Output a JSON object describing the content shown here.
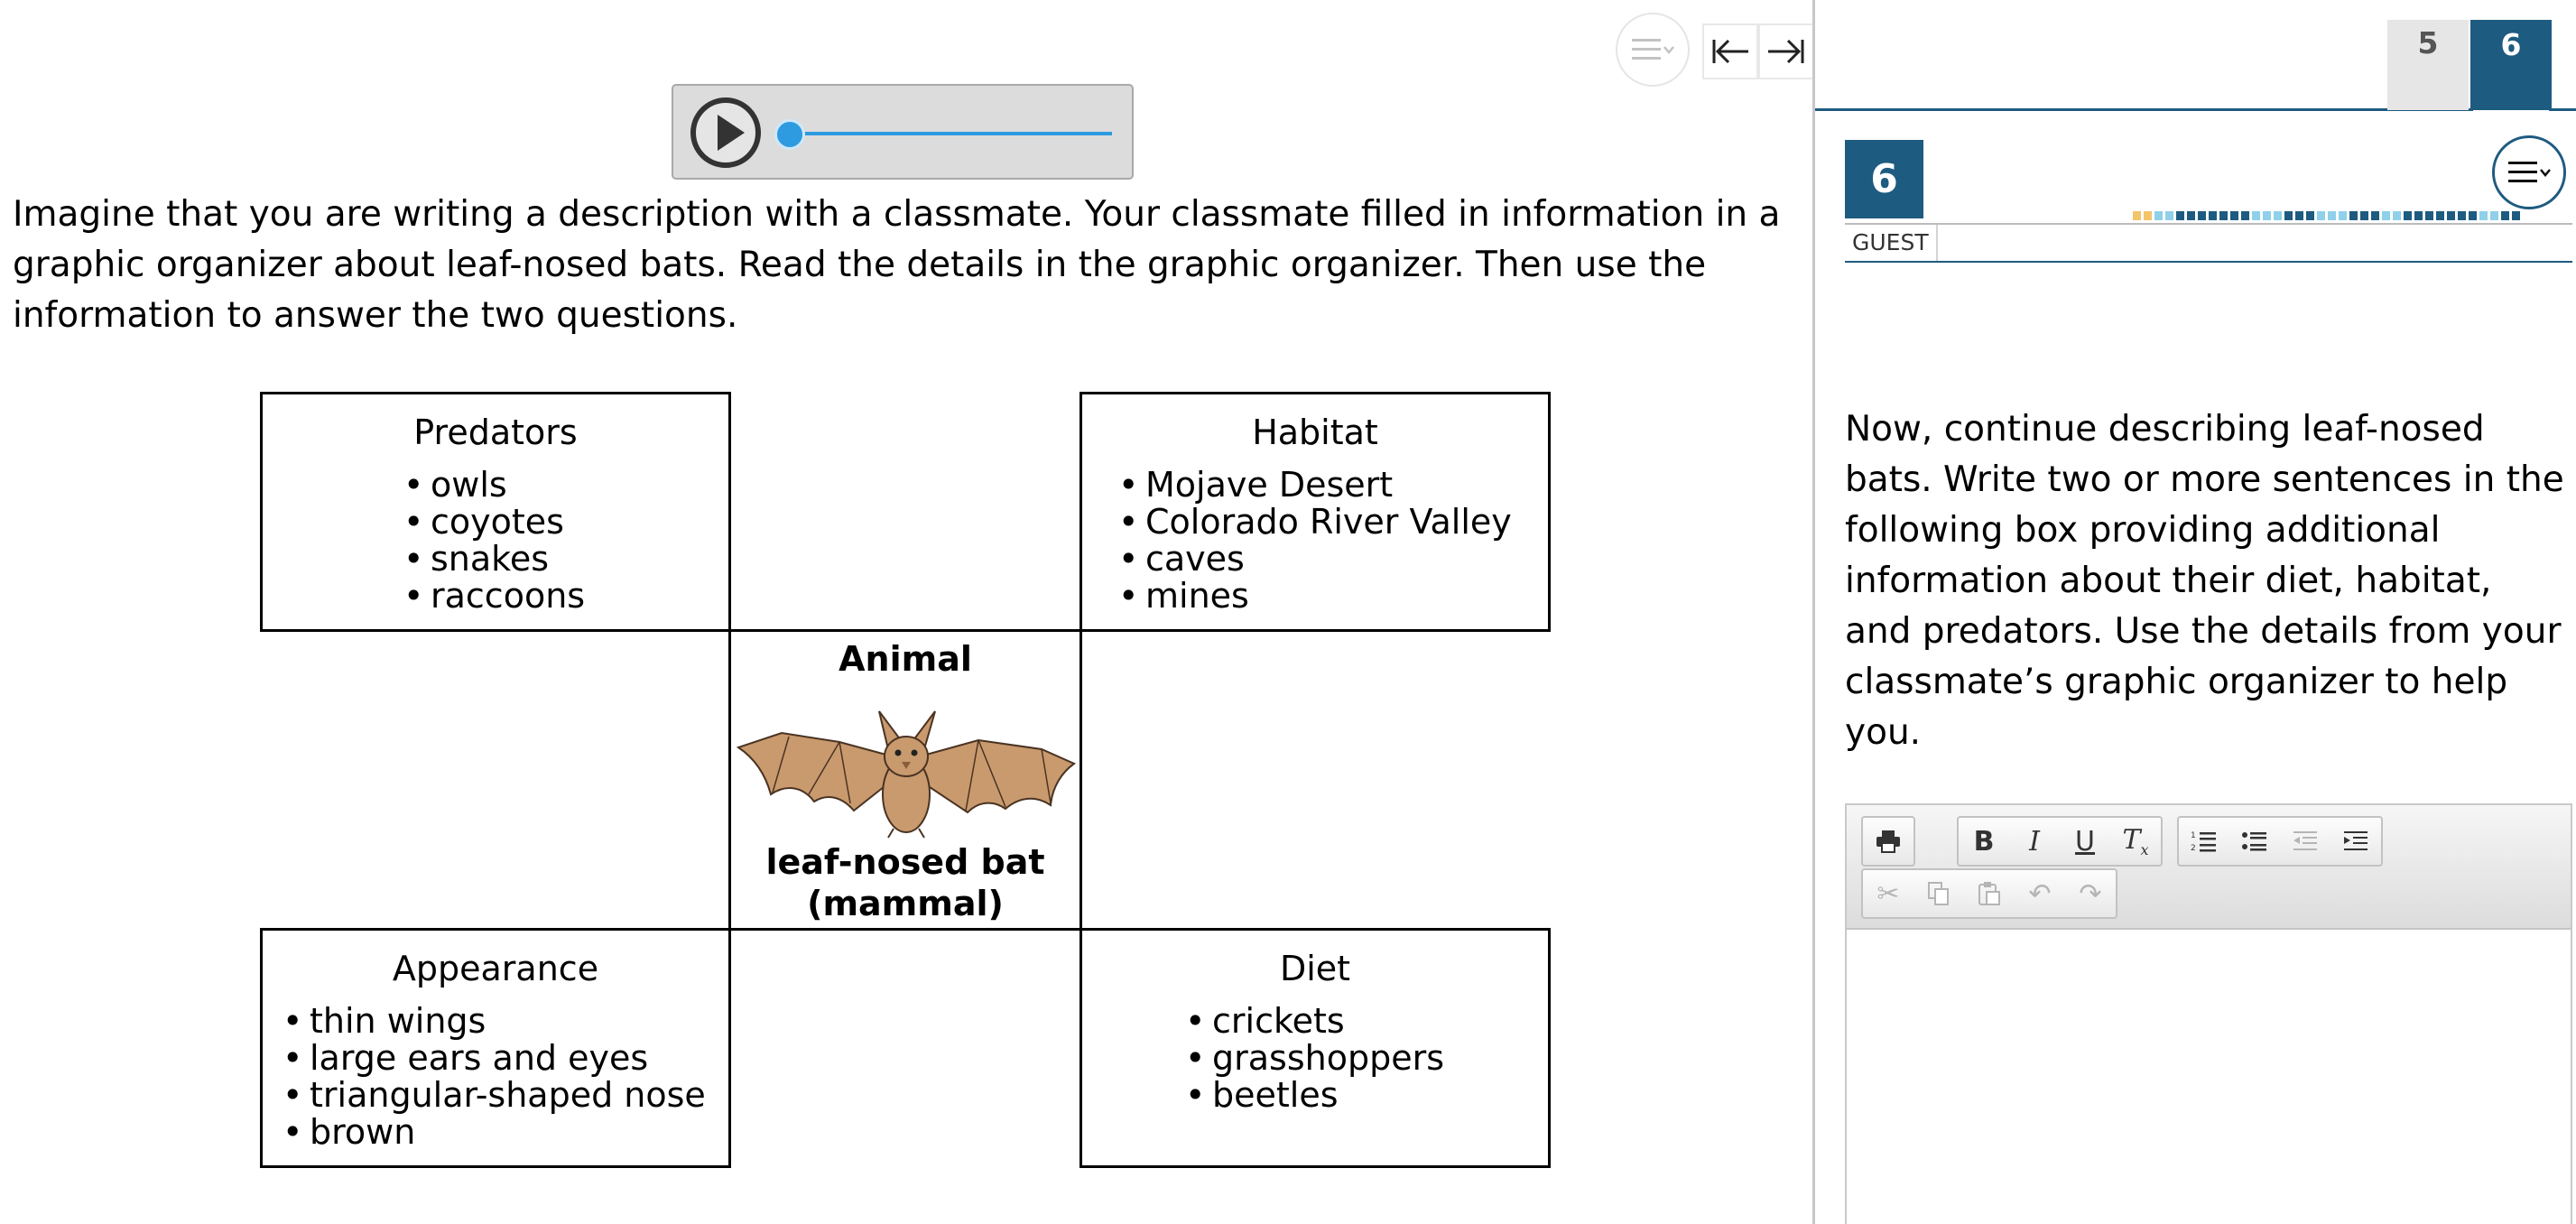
{
  "left_pane": {
    "intro_text": "Imagine that you are writing a description with a classmate. Your classmate filled in information in a graphic organizer about leaf-nosed bats. Read the details in the graphic organizer. Then use the information to answer the two questions.",
    "organizer": {
      "predators": {
        "heading": "Predators",
        "items": [
          "owls",
          "coyotes",
          "snakes",
          "raccoons"
        ]
      },
      "habitat": {
        "heading": "Habitat",
        "items": [
          "Mojave Desert",
          "Colorado River Valley",
          "caves",
          "mines"
        ]
      },
      "center": {
        "title": "Animal",
        "caption_line1": "leaf-nosed bat",
        "caption_line2": "(mammal)"
      },
      "appearance": {
        "heading": "Appearance",
        "items": [
          "thin wings",
          "large ears and eyes",
          "triangular-shaped nose",
          "brown"
        ]
      },
      "diet": {
        "heading": "Diet",
        "items": [
          "crickets",
          "grasshoppers",
          "beetles"
        ]
      }
    },
    "audio": {
      "progress": 0
    }
  },
  "toolbar_icons": {
    "left_menu": "hamburger-menu-icon",
    "collapse": "arrow-left-to-bar-icon",
    "expand": "arrow-right-to-bar-icon"
  },
  "right_pane": {
    "tabs": [
      {
        "label": "5",
        "active": false
      },
      {
        "label": "6",
        "active": true
      }
    ],
    "question_number": "6",
    "user_label": "GUEST",
    "prompt_text": "Now, continue describing leaf-nosed bats. Write two or more sentences in the following box providing additional information about their diet, habitat, and predators. Use the details from your classmate’s graphic organizer to help you.",
    "audio": {
      "progress": 0
    },
    "editor": {
      "buttons_row1": [
        "print",
        "bold",
        "italic",
        "underline",
        "remove-format",
        "numbered-list",
        "bulleted-list",
        "decrease-indent",
        "increase-indent"
      ],
      "buttons_row2": [
        "cut",
        "copy",
        "paste",
        "undo",
        "redo"
      ],
      "content": ""
    }
  },
  "colors": {
    "accent": "#1e5b80",
    "audio_blue": "#2e9be0",
    "bat_fill": "#c99a6e",
    "progress_segments": [
      "#f3c56a",
      "#8fd0ea",
      "#1e5b80"
    ]
  }
}
